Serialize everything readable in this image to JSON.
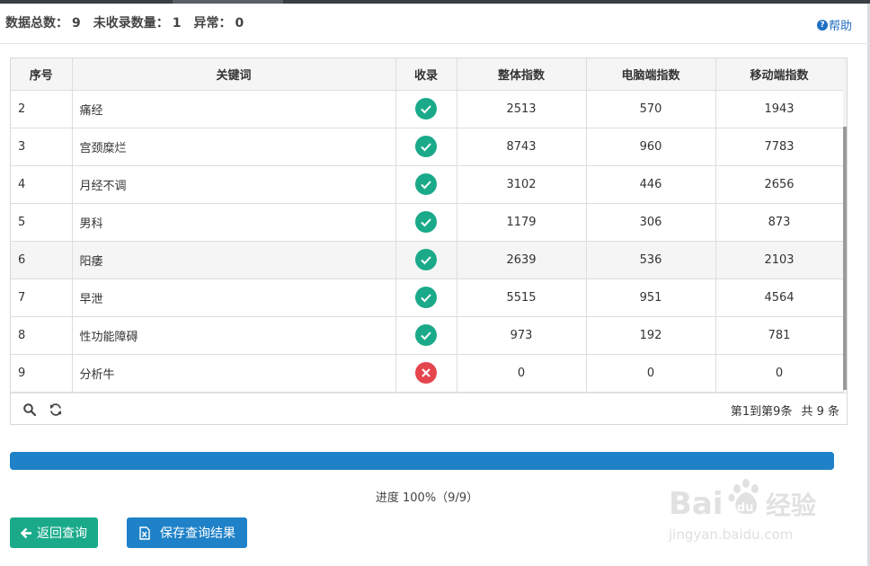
{
  "summary": {
    "total_label": "数据总数：",
    "total_value": "9",
    "uncollected_label": "未收录数量：",
    "uncollected_value": "1",
    "error_label": "异常：",
    "error_value": "0"
  },
  "help": {
    "icon": "question-circle-icon",
    "label": "帮助"
  },
  "table": {
    "columns": [
      "序号",
      "关键词",
      "收录",
      "整体指数",
      "电脑端指数",
      "移动端指数"
    ],
    "rows": [
      {
        "index": "2",
        "keyword": "痛经",
        "status": "ok",
        "overall": "2513",
        "pc": "570",
        "mobile": "1943"
      },
      {
        "index": "3",
        "keyword": "宫颈糜烂",
        "status": "ok",
        "overall": "8743",
        "pc": "960",
        "mobile": "7783"
      },
      {
        "index": "4",
        "keyword": "月经不调",
        "status": "ok",
        "overall": "3102",
        "pc": "446",
        "mobile": "2656"
      },
      {
        "index": "5",
        "keyword": "男科",
        "status": "ok",
        "overall": "1179",
        "pc": "306",
        "mobile": "873"
      },
      {
        "index": "6",
        "keyword": "阳痿",
        "status": "ok",
        "overall": "2639",
        "pc": "536",
        "mobile": "2103"
      },
      {
        "index": "7",
        "keyword": "早泄",
        "status": "ok",
        "overall": "5515",
        "pc": "951",
        "mobile": "4564"
      },
      {
        "index": "8",
        "keyword": "性功能障碍",
        "status": "ok",
        "overall": "973",
        "pc": "192",
        "mobile": "781"
      },
      {
        "index": "9",
        "keyword": "分析牛",
        "status": "fail",
        "overall": "0",
        "pc": "0",
        "mobile": "0"
      }
    ],
    "highlighted_row": 4
  },
  "footer": {
    "search_icon": "search-icon",
    "refresh_icon": "refresh-icon",
    "page_range": "第1到第9条",
    "page_total": "共 9 条"
  },
  "progress": {
    "percent": 100,
    "text": "进度 100%（9/9）"
  },
  "buttons": {
    "back_label": "返回查询",
    "back_icon": "arrow-left-icon",
    "save_label": "保存查询结果",
    "save_icon": "excel-file-icon"
  },
  "watermark": {
    "brand": "Bai du 经验",
    "url": "jingyan.baidu.com"
  },
  "colors": {
    "green": "#1aaa8a",
    "red": "#e5454d",
    "blue": "#1f82c8",
    "help_blue": "#1f6fc1"
  }
}
